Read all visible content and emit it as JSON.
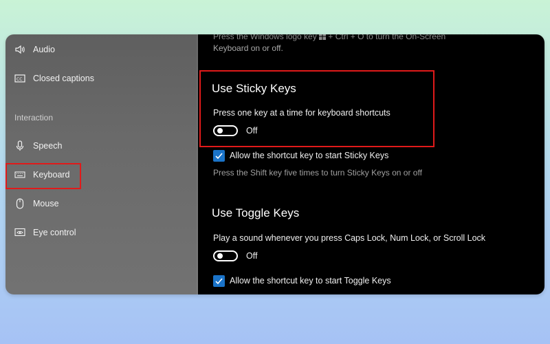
{
  "sidebar": {
    "items_top": [
      {
        "label": "Audio",
        "icon": "speaker-icon"
      },
      {
        "label": "Closed captions",
        "icon": "closed-captions-icon"
      }
    ],
    "section_label": "Interaction",
    "items_interaction": [
      {
        "label": "Speech",
        "icon": "microphone-icon"
      },
      {
        "label": "Keyboard",
        "icon": "keyboard-icon",
        "selected": true
      },
      {
        "label": "Mouse",
        "icon": "mouse-icon"
      },
      {
        "label": "Eye control",
        "icon": "eye-control-icon"
      }
    ]
  },
  "content": {
    "top_text_line1": "Press the Windows logo key",
    "top_text_line1b": "+ Ctrl + O to turn the On-Screen",
    "top_text_line2": "Keyboard on or off.",
    "sticky": {
      "title": "Use Sticky Keys",
      "description": "Press one key at a time for keyboard shortcuts",
      "toggle_state": "Off",
      "checkbox_label": "Allow the shortcut key to start Sticky Keys",
      "checkbox_checked": true,
      "hint": "Press the Shift key five times to turn Sticky Keys on or off"
    },
    "toggle": {
      "title": "Use Toggle Keys",
      "description": "Play a sound whenever you press Caps Lock, Num Lock, or Scroll Lock",
      "toggle_state": "Off",
      "checkbox_label": "Allow the shortcut key to start Toggle Keys",
      "checkbox_checked": true
    }
  },
  "colors": {
    "accent": "#1a73c8",
    "highlight": "#e11a1a",
    "content_bg": "#000000",
    "sidebar_bg": "#6a6a6a"
  }
}
